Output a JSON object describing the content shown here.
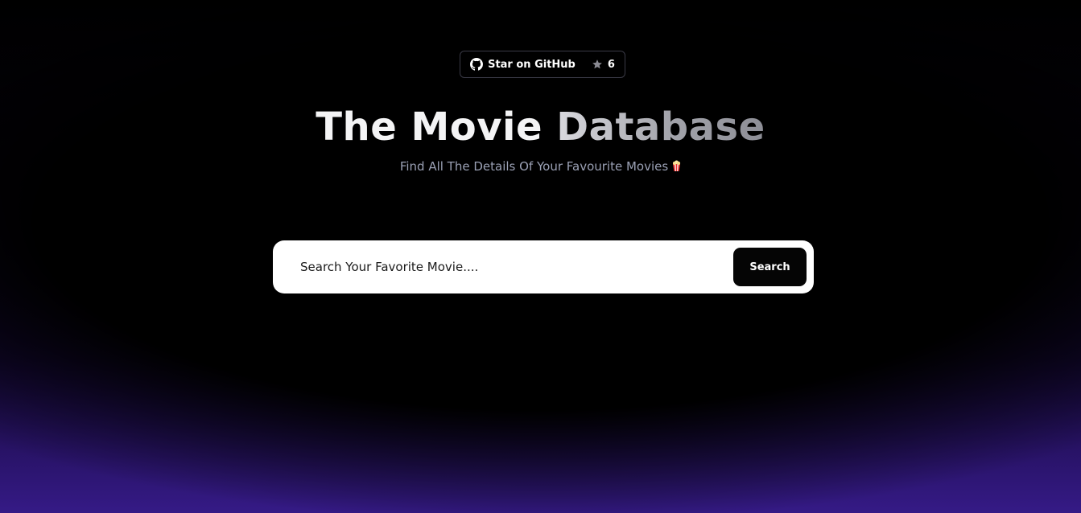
{
  "github_badge": {
    "label": "Star on GitHub",
    "star_count": "6",
    "icon": "github-icon",
    "star_icon": "star-icon"
  },
  "header": {
    "title_part1": "The Movie ",
    "title_part2": "Database",
    "subtitle": "Find All The Details Of Your Favourite Movies",
    "subtitle_icon": "popcorn-icon"
  },
  "search": {
    "placeholder": "Search Your Favorite Movie....",
    "value": "",
    "button_label": "Search"
  },
  "colors": {
    "background": "#000000",
    "glow_purple": "#351a86",
    "search_bar_bg": "#ffffff",
    "search_button_bg": "#050505",
    "subtitle_text": "#9aa0b4"
  }
}
